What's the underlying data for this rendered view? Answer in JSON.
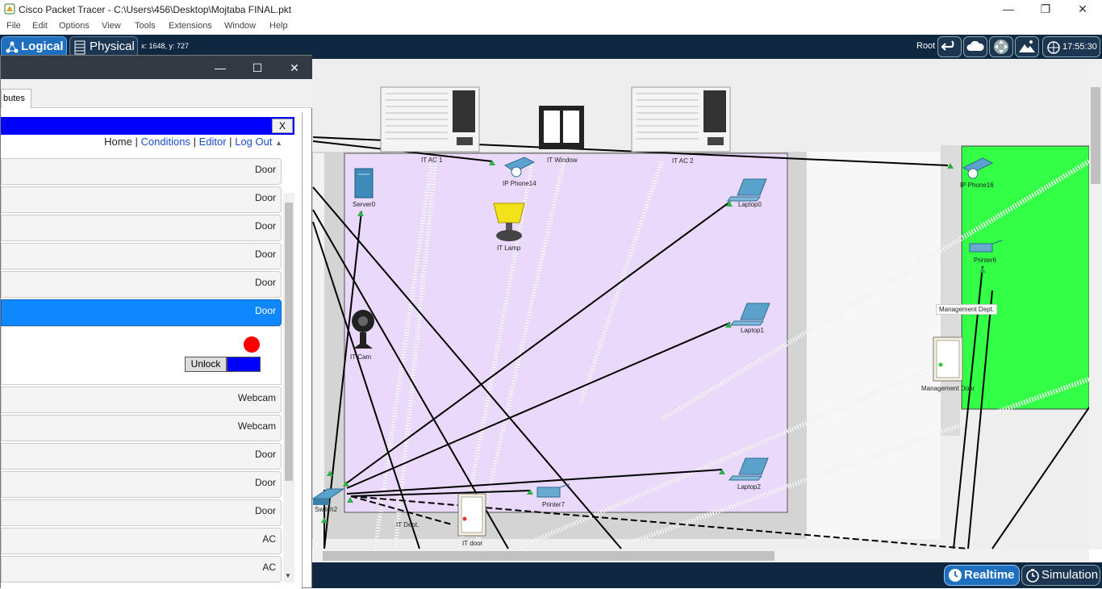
{
  "window": {
    "title": "Cisco Packet Tracer - C:\\Users\\456\\Desktop\\Mojtaba FINAL.pkt",
    "minimize": "—",
    "maximize": "❐",
    "close": "✕"
  },
  "menu": [
    "File",
    "Edit",
    "Options",
    "View",
    "Tools",
    "Extensions",
    "Window",
    "Help"
  ],
  "toolbar": {
    "logical_label": "Logical",
    "physical_label": "Physical",
    "coords": "x: 1648, y: 727",
    "root_label": "Root",
    "time": "17:55:30"
  },
  "bottombar": {
    "realtime_label": "Realtime",
    "simulation_label": "Simulation"
  },
  "popup": {
    "minimize": "—",
    "maximize": "☐",
    "close": "✕",
    "tab_label": "butes",
    "close_x": "X",
    "nav": {
      "home": "Home",
      "conditions": "Conditions",
      "editor": "Editor",
      "logout": "Log Out",
      "sep": "|"
    },
    "rows_top": [
      "Door",
      "Door",
      "Door",
      "Door",
      "Door"
    ],
    "selected_row": "Door",
    "unlock_label": "Unlock",
    "rows_bottom": [
      "Webcam",
      "Webcam",
      "Door",
      "Door",
      "Door",
      "AC",
      "AC"
    ]
  },
  "devices": {
    "it_ac1": "IT AC 1",
    "it_window": "IT Window",
    "it_ac2": "IT AC 2",
    "ip_phone14": "IP Phone14",
    "ip_phone16": "IP Phone16",
    "server0": "Server0",
    "it_lamp": "IT Lamp",
    "laptop0": "Laptop0",
    "laptop1": "Laptop1",
    "laptop2": "Laptop2",
    "printer6": "Printer6",
    "printer7": "Printer7",
    "it_cam": "IT Cam",
    "switch2": "Switch2",
    "it_dept": "IT Dept.",
    "it_door": "IT door",
    "mgmt_dept": "Management Dept.",
    "mgmt_door": "Management Door"
  },
  "colors": {
    "it_room": "#ead9fb",
    "mgmt_room": "#33ff47",
    "toolbar_bg": "#0f2741",
    "selected_row": "#0f88ff",
    "header_blue": "#0000ff"
  }
}
